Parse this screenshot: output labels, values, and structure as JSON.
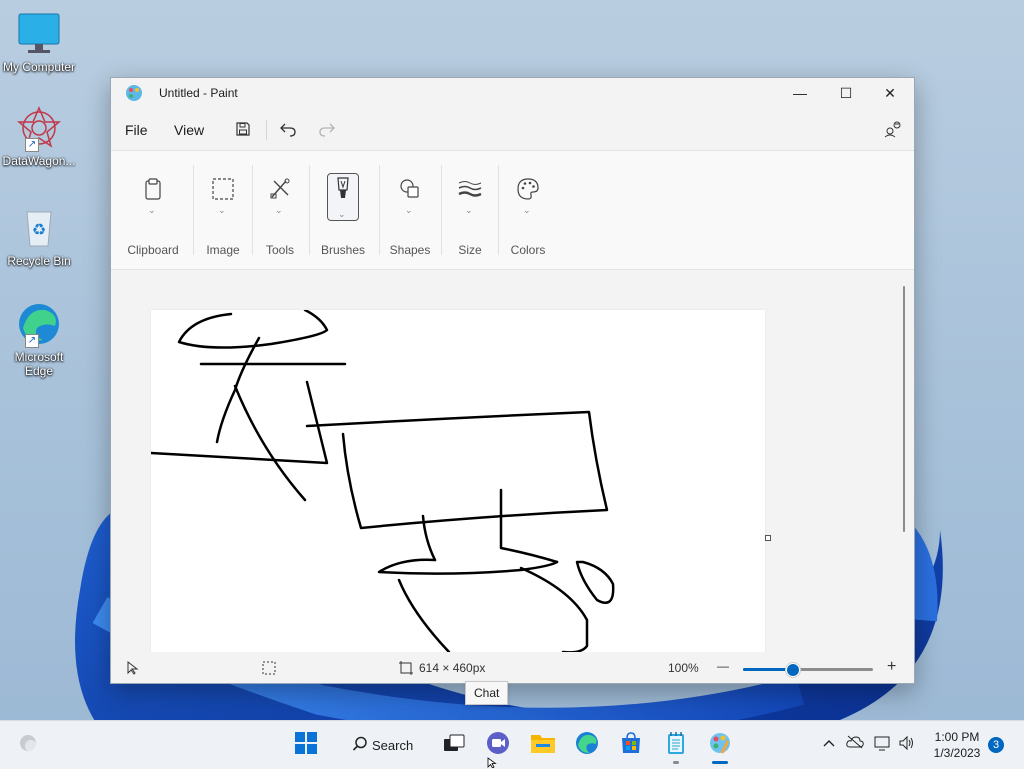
{
  "desktop": {
    "icons": [
      {
        "label": "My Computer",
        "icon": "monitor-icon"
      },
      {
        "label": "DataWagon...",
        "icon": "datawagon-icon"
      },
      {
        "label": "Recycle Bin",
        "icon": "recycle-bin-icon"
      },
      {
        "label": "Microsoft Edge",
        "icon": "edge-icon"
      }
    ]
  },
  "window": {
    "title": "Untitled - Paint",
    "controls": {
      "minimize": "—",
      "maximize": "☐",
      "close": "✕"
    }
  },
  "menubar": {
    "file": "File",
    "view": "View",
    "icons": [
      "save-icon",
      "undo-icon",
      "redo-icon",
      "settings-icon"
    ]
  },
  "ribbon": {
    "groups": [
      {
        "label": "Clipboard",
        "icon": "clipboard-icon"
      },
      {
        "label": "Image",
        "icon": "select-icon"
      },
      {
        "label": "Tools",
        "icon": "tools-icon"
      },
      {
        "label": "Brushes",
        "icon": "brush-icon",
        "selected": true
      },
      {
        "label": "Shapes",
        "icon": "shapes-icon"
      },
      {
        "label": "Size",
        "icon": "size-icon"
      },
      {
        "label": "Colors",
        "icon": "palette-icon"
      }
    ]
  },
  "statusbar": {
    "canvas_size": "614 × 460px",
    "zoom": "100%",
    "zoom_minus": "—",
    "zoom_plus": "+",
    "zoom_slider_fraction": 0.38
  },
  "tooltip": {
    "text": "Chat"
  },
  "taskbar": {
    "search_label": "Search",
    "apps": [
      "start-icon",
      "search-icon",
      "task-view-icon",
      "chat-icon",
      "file-explorer-icon",
      "edge-icon",
      "store-icon",
      "notepad-icon",
      "paint-icon"
    ],
    "time": "1:00 PM",
    "date": "1/3/2023",
    "notifications": "3"
  },
  "colors": {
    "accent": "#0067c0"
  }
}
